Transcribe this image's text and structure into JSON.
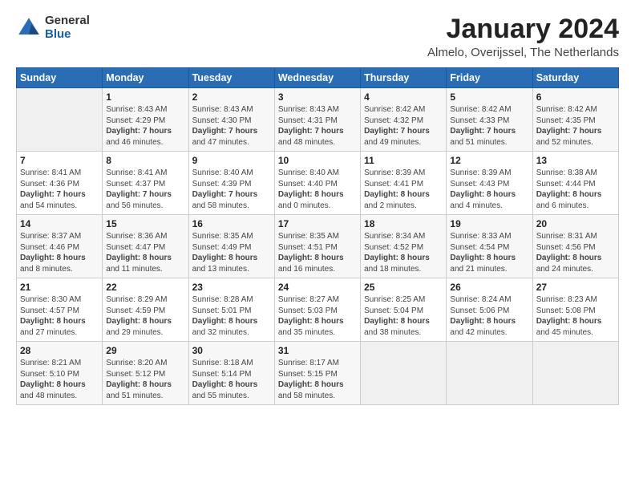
{
  "logo": {
    "general": "General",
    "blue": "Blue"
  },
  "title": "January 2024",
  "location": "Almelo, Overijssel, The Netherlands",
  "days_of_week": [
    "Sunday",
    "Monday",
    "Tuesday",
    "Wednesday",
    "Thursday",
    "Friday",
    "Saturday"
  ],
  "weeks": [
    [
      {
        "day": "",
        "info": ""
      },
      {
        "day": "1",
        "info": "Sunrise: 8:43 AM\nSunset: 4:29 PM\nDaylight: 7 hours\nand 46 minutes."
      },
      {
        "day": "2",
        "info": "Sunrise: 8:43 AM\nSunset: 4:30 PM\nDaylight: 7 hours\nand 47 minutes."
      },
      {
        "day": "3",
        "info": "Sunrise: 8:43 AM\nSunset: 4:31 PM\nDaylight: 7 hours\nand 48 minutes."
      },
      {
        "day": "4",
        "info": "Sunrise: 8:42 AM\nSunset: 4:32 PM\nDaylight: 7 hours\nand 49 minutes."
      },
      {
        "day": "5",
        "info": "Sunrise: 8:42 AM\nSunset: 4:33 PM\nDaylight: 7 hours\nand 51 minutes."
      },
      {
        "day": "6",
        "info": "Sunrise: 8:42 AM\nSunset: 4:35 PM\nDaylight: 7 hours\nand 52 minutes."
      }
    ],
    [
      {
        "day": "7",
        "info": "Sunrise: 8:41 AM\nSunset: 4:36 PM\nDaylight: 7 hours\nand 54 minutes."
      },
      {
        "day": "8",
        "info": "Sunrise: 8:41 AM\nSunset: 4:37 PM\nDaylight: 7 hours\nand 56 minutes."
      },
      {
        "day": "9",
        "info": "Sunrise: 8:40 AM\nSunset: 4:39 PM\nDaylight: 7 hours\nand 58 minutes."
      },
      {
        "day": "10",
        "info": "Sunrise: 8:40 AM\nSunset: 4:40 PM\nDaylight: 8 hours\nand 0 minutes."
      },
      {
        "day": "11",
        "info": "Sunrise: 8:39 AM\nSunset: 4:41 PM\nDaylight: 8 hours\nand 2 minutes."
      },
      {
        "day": "12",
        "info": "Sunrise: 8:39 AM\nSunset: 4:43 PM\nDaylight: 8 hours\nand 4 minutes."
      },
      {
        "day": "13",
        "info": "Sunrise: 8:38 AM\nSunset: 4:44 PM\nDaylight: 8 hours\nand 6 minutes."
      }
    ],
    [
      {
        "day": "14",
        "info": "Sunrise: 8:37 AM\nSunset: 4:46 PM\nDaylight: 8 hours\nand 8 minutes."
      },
      {
        "day": "15",
        "info": "Sunrise: 8:36 AM\nSunset: 4:47 PM\nDaylight: 8 hours\nand 11 minutes."
      },
      {
        "day": "16",
        "info": "Sunrise: 8:35 AM\nSunset: 4:49 PM\nDaylight: 8 hours\nand 13 minutes."
      },
      {
        "day": "17",
        "info": "Sunrise: 8:35 AM\nSunset: 4:51 PM\nDaylight: 8 hours\nand 16 minutes."
      },
      {
        "day": "18",
        "info": "Sunrise: 8:34 AM\nSunset: 4:52 PM\nDaylight: 8 hours\nand 18 minutes."
      },
      {
        "day": "19",
        "info": "Sunrise: 8:33 AM\nSunset: 4:54 PM\nDaylight: 8 hours\nand 21 minutes."
      },
      {
        "day": "20",
        "info": "Sunrise: 8:31 AM\nSunset: 4:56 PM\nDaylight: 8 hours\nand 24 minutes."
      }
    ],
    [
      {
        "day": "21",
        "info": "Sunrise: 8:30 AM\nSunset: 4:57 PM\nDaylight: 8 hours\nand 27 minutes."
      },
      {
        "day": "22",
        "info": "Sunrise: 8:29 AM\nSunset: 4:59 PM\nDaylight: 8 hours\nand 29 minutes."
      },
      {
        "day": "23",
        "info": "Sunrise: 8:28 AM\nSunset: 5:01 PM\nDaylight: 8 hours\nand 32 minutes."
      },
      {
        "day": "24",
        "info": "Sunrise: 8:27 AM\nSunset: 5:03 PM\nDaylight: 8 hours\nand 35 minutes."
      },
      {
        "day": "25",
        "info": "Sunrise: 8:25 AM\nSunset: 5:04 PM\nDaylight: 8 hours\nand 38 minutes."
      },
      {
        "day": "26",
        "info": "Sunrise: 8:24 AM\nSunset: 5:06 PM\nDaylight: 8 hours\nand 42 minutes."
      },
      {
        "day": "27",
        "info": "Sunrise: 8:23 AM\nSunset: 5:08 PM\nDaylight: 8 hours\nand 45 minutes."
      }
    ],
    [
      {
        "day": "28",
        "info": "Sunrise: 8:21 AM\nSunset: 5:10 PM\nDaylight: 8 hours\nand 48 minutes."
      },
      {
        "day": "29",
        "info": "Sunrise: 8:20 AM\nSunset: 5:12 PM\nDaylight: 8 hours\nand 51 minutes."
      },
      {
        "day": "30",
        "info": "Sunrise: 8:18 AM\nSunset: 5:14 PM\nDaylight: 8 hours\nand 55 minutes."
      },
      {
        "day": "31",
        "info": "Sunrise: 8:17 AM\nSunset: 5:15 PM\nDaylight: 8 hours\nand 58 minutes."
      },
      {
        "day": "",
        "info": ""
      },
      {
        "day": "",
        "info": ""
      },
      {
        "day": "",
        "info": ""
      }
    ]
  ]
}
